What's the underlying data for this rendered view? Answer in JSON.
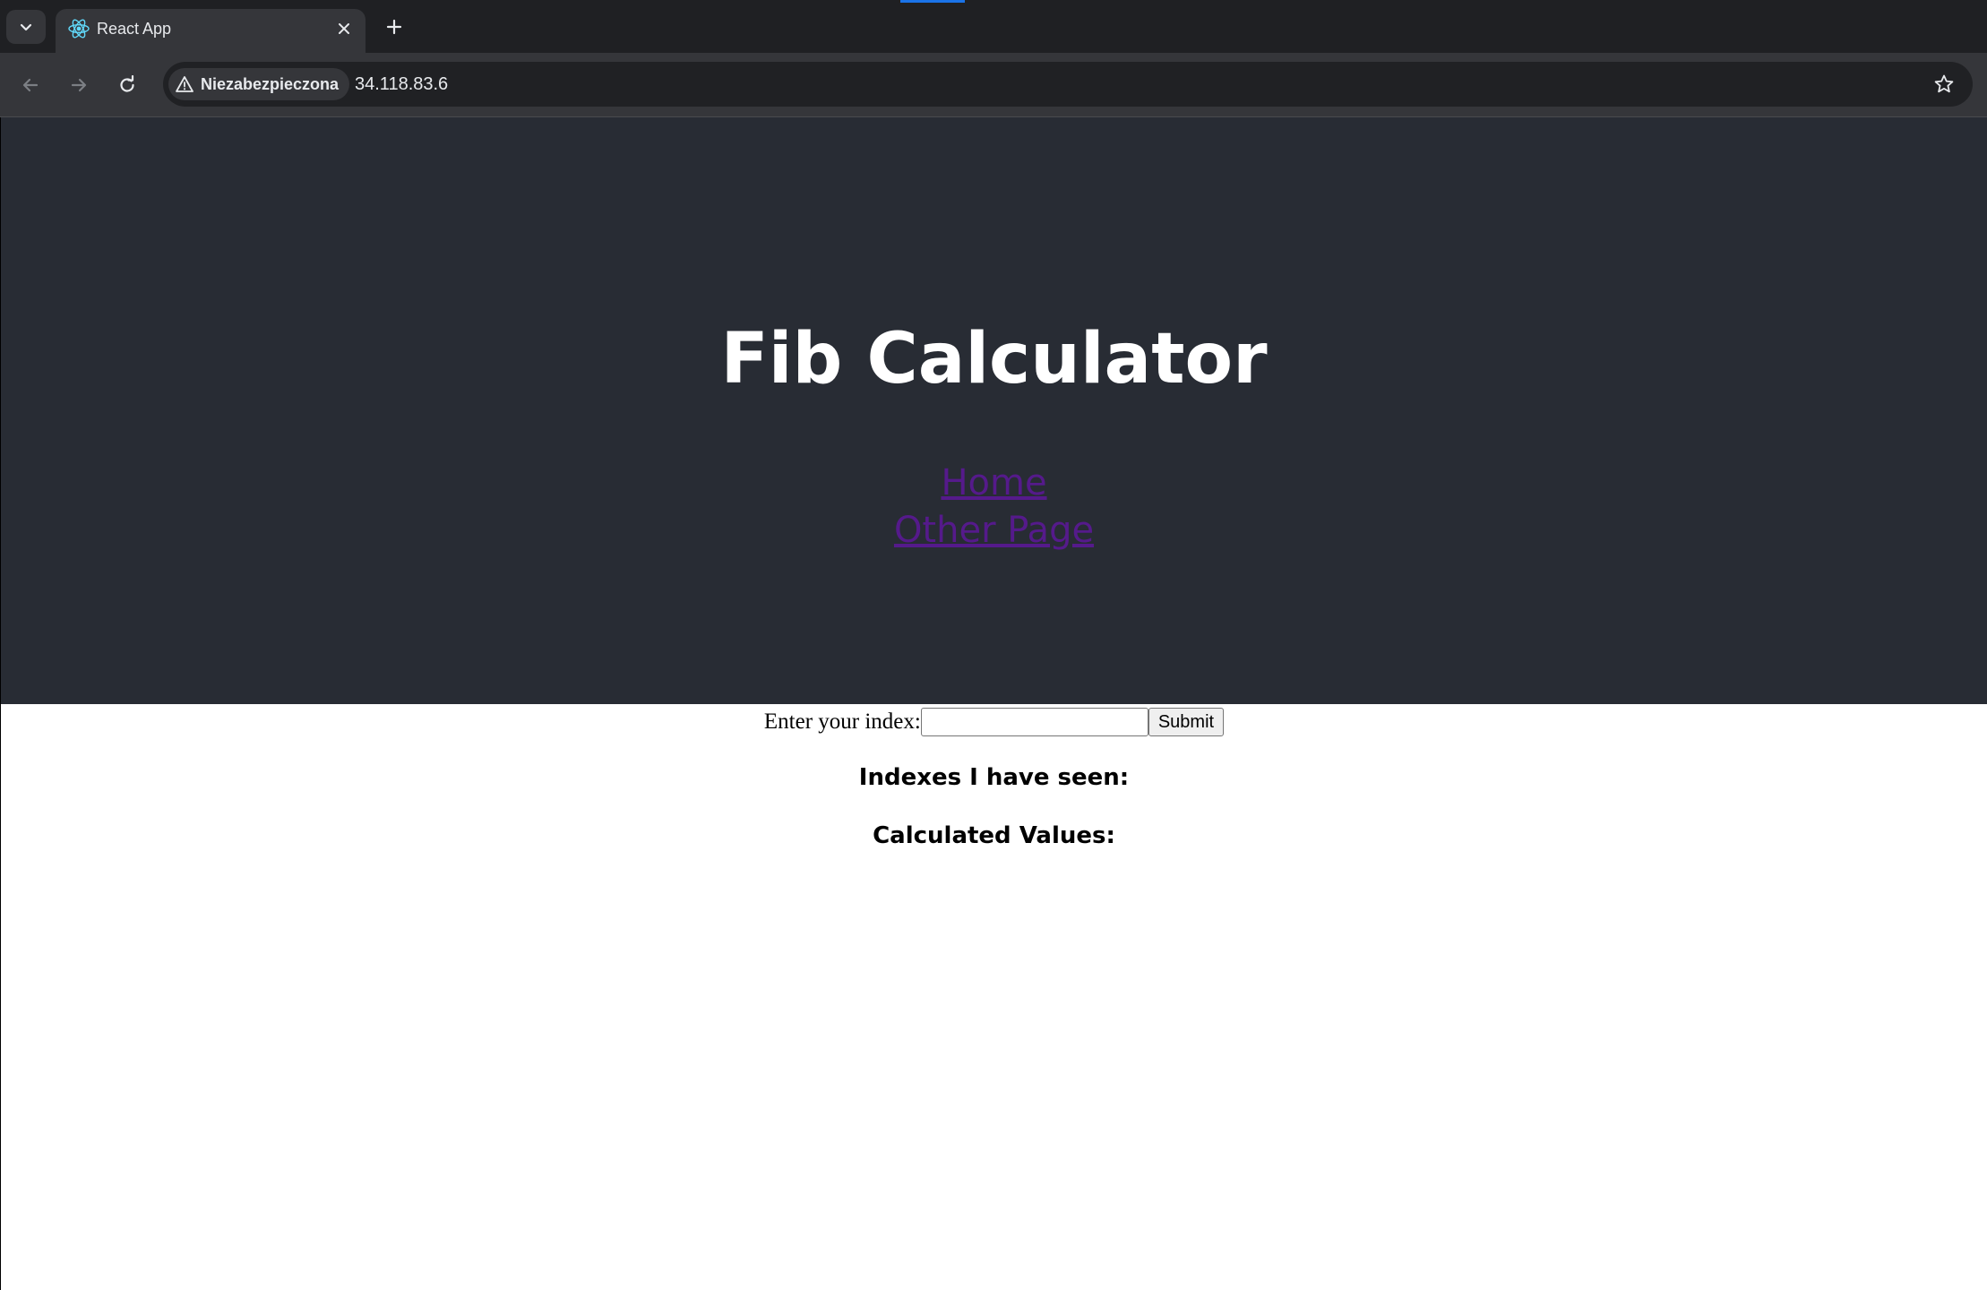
{
  "browser": {
    "tab": {
      "title": "React App",
      "favicon": "react-icon"
    },
    "address_bar": {
      "security_label": "Niezabezpieczona",
      "url": "34.118.83.6"
    },
    "icons": {
      "tab_search": "chevron-down-icon",
      "close_tab": "close-icon",
      "new_tab": "plus-icon",
      "back": "arrow-left-icon",
      "forward": "arrow-right-icon",
      "reload": "reload-icon",
      "security": "warning-icon",
      "bookmark": "star-icon"
    },
    "colors": {
      "tabstrip": "#1f2023",
      "toolbar": "#35363a",
      "accent": "#1a73e8"
    }
  },
  "app": {
    "title": "Fib Calculator",
    "nav": {
      "home_label": "Home",
      "other_label": "Other Page"
    },
    "form": {
      "label": "Enter your index:",
      "input_value": "",
      "submit_label": "Submit"
    },
    "sections": {
      "indexes_heading": "Indexes I have seen:",
      "values_heading": "Calculated Values:"
    },
    "colors": {
      "header_bg": "#282c34",
      "link": "#551a8b"
    }
  }
}
